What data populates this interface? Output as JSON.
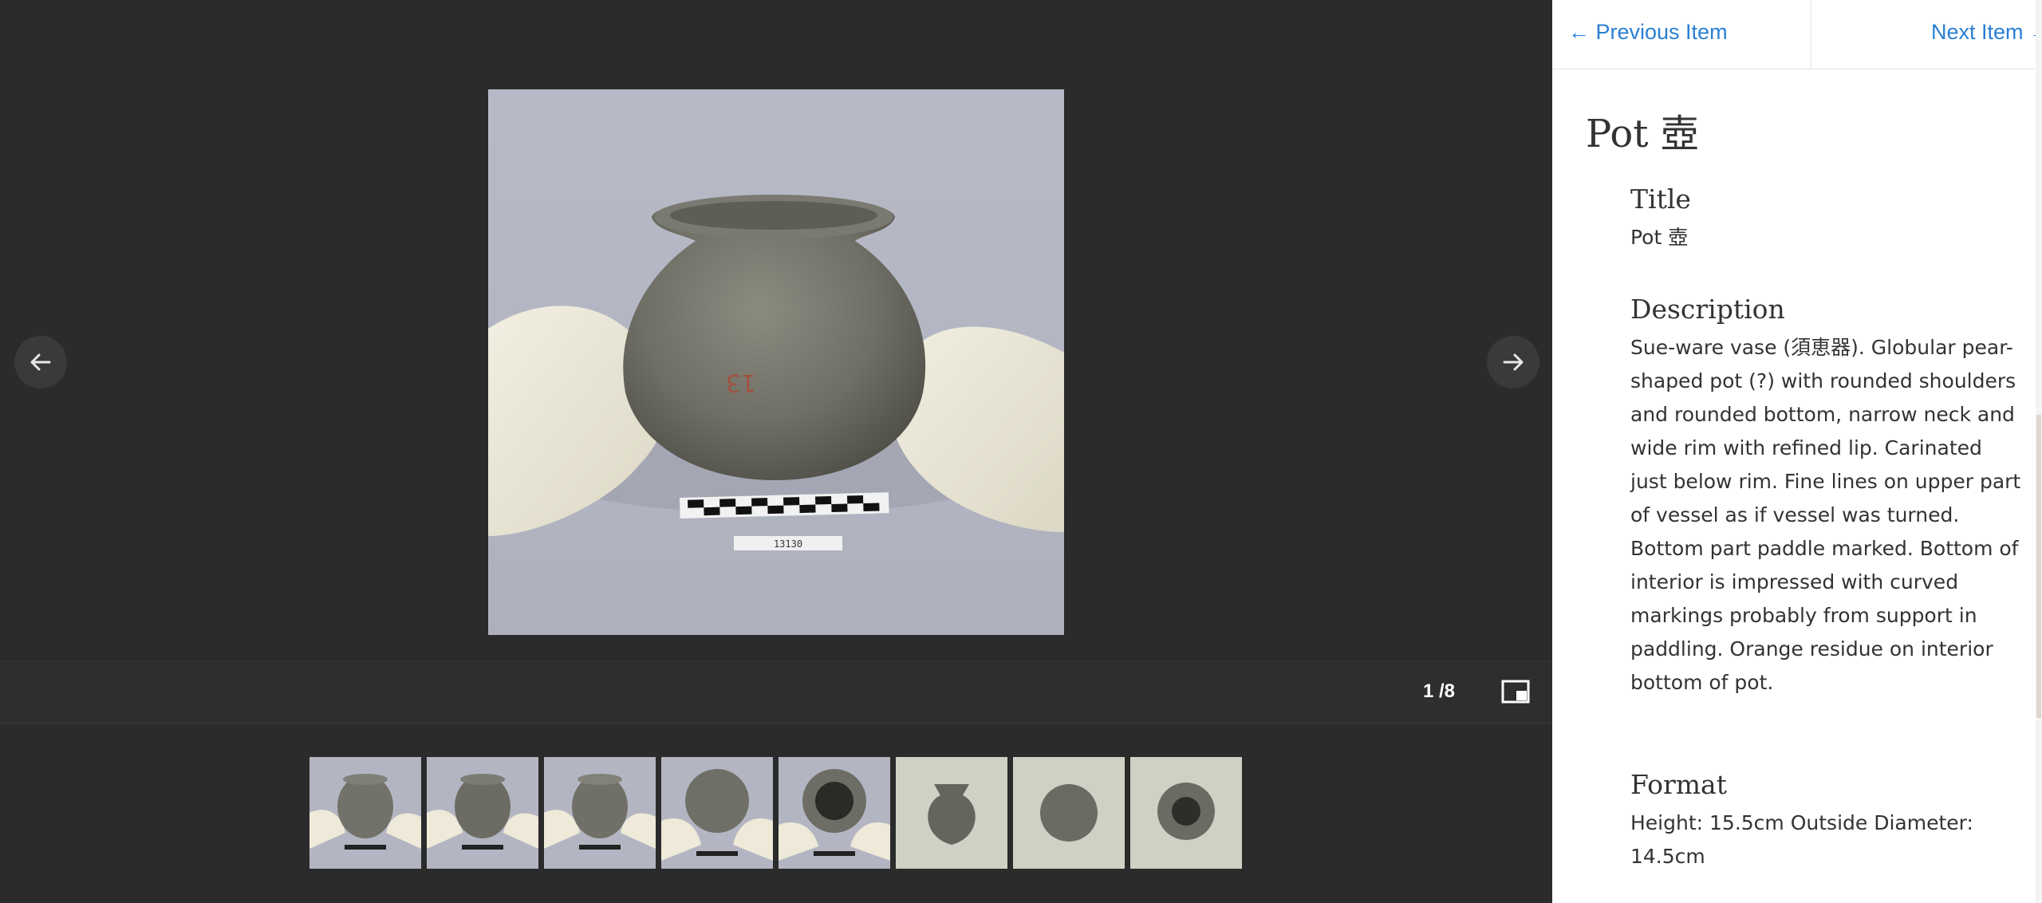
{
  "viewer": {
    "counter": "1 /8",
    "thumbnails": [
      {
        "name": "thumb-1-side-view"
      },
      {
        "name": "thumb-2-side-view"
      },
      {
        "name": "thumb-3-side-view"
      },
      {
        "name": "thumb-4-top-angled"
      },
      {
        "name": "thumb-5-mouth-view"
      },
      {
        "name": "thumb-6-profile"
      },
      {
        "name": "thumb-7-bottom-view"
      },
      {
        "name": "thumb-8-top-view"
      }
    ],
    "icons": {
      "prev": "arrow-left-icon",
      "next": "arrow-right-icon",
      "layout": "layout-toggle-icon"
    },
    "main_photo": {
      "scale_label": "13130",
      "mark": "13"
    }
  },
  "panel": {
    "prev_item": "← Previous Item",
    "next_item": "Next Item →",
    "heading": "Pot 壺",
    "fields": {
      "title_label": "Title",
      "title_value": "Pot 壺",
      "description_label": "Description",
      "description_value": "Sue-ware vase (須恵器). Globular pear-shaped pot (?) with rounded shoulders and rounded bottom, narrow neck and wide rim with refined lip. Carinated just below rim. Fine lines on upper part of vessel as if vessel was turned. Bottom part paddle marked. Bottom of interior is impressed with curved markings probably from support in paddling. Orange residue on interior bottom of pot.",
      "format_label": "Format",
      "format_value": "Height: 15.5cm Outside Diameter: 14.5cm"
    }
  },
  "colors": {
    "viewer_bg": "#2b2b2b",
    "link": "#2a7fd4",
    "panel_bg": "#ffffff"
  }
}
